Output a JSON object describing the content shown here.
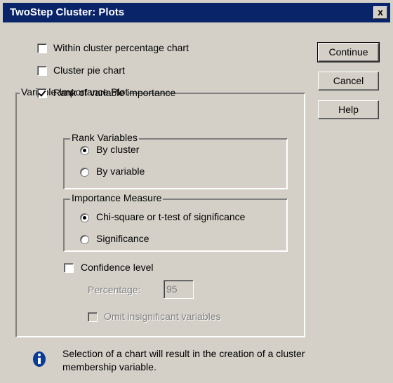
{
  "window": {
    "title": "TwoStep Cluster: Plots",
    "close_label": "x"
  },
  "options": {
    "within_cluster_label": "Within cluster percentage chart",
    "within_cluster_checked": false,
    "pie_chart_label": "Cluster pie chart",
    "pie_chart_checked": false
  },
  "buttons": {
    "continue": "Continue",
    "cancel": "Cancel",
    "help": "Help"
  },
  "variable_importance": {
    "group_title": "Variable Importance Plot",
    "rank_label": "Rank of variable importance",
    "rank_checked": true,
    "rank_variables": {
      "title": "Rank Variables",
      "by_cluster": "By cluster",
      "by_variable": "By variable",
      "selected": "By cluster"
    },
    "importance_measure": {
      "title": "Importance Measure",
      "chi_square": "Chi-square or t-test of significance",
      "significance": "Significance",
      "selected": "Chi-square or t-test of significance"
    },
    "confidence": {
      "label": "Confidence level",
      "checked": false,
      "percentage_label": "Percentage:",
      "percentage_value": "95",
      "omit_label": "Omit insignificant variables",
      "omit_checked": false
    }
  },
  "info": {
    "icon": "info-icon",
    "line1": "Selection of a chart will result in the creation of a cluster",
    "line2": "membership variable."
  },
  "colors": {
    "titlebar": "#0a246a",
    "dialog": "#d4d0c8",
    "info_icon": "#0a3c94"
  }
}
